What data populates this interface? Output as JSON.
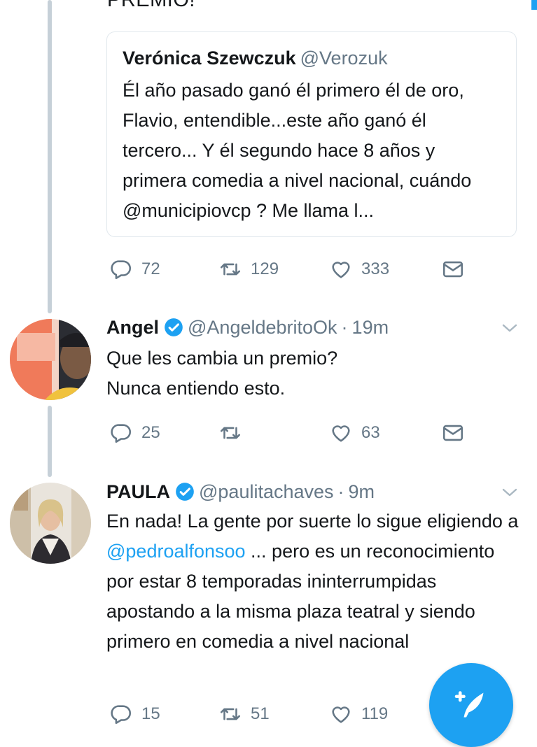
{
  "prev_tweet": {
    "text_fragment": "PREMIO!",
    "quote": {
      "name": "Verónica Szewczuk",
      "handle": "@Verozuk",
      "text": "Él año pasado ganó él primero él de oro, Flavio, entendible...este año ganó él tercero... Y él segundo hace 8 años y primera comedia a nivel nacional, cuándo @municipiovcp ? Me llama l..."
    },
    "replies": "72",
    "retweets": "129",
    "likes": "333"
  },
  "tweets": [
    {
      "name": "Angel",
      "verified": true,
      "handle": "@AngeldebritoOk",
      "separator": "·",
      "time": "19m",
      "line1": "Que les cambia un premio?",
      "line2": "Nunca entiendo esto.",
      "replies": "25",
      "retweets": "",
      "likes": "63"
    },
    {
      "name": "PAULA",
      "verified": true,
      "handle": "@paulitachaves",
      "separator": "·",
      "time": "9m",
      "text_before": "En nada! La gente por suerte lo sigue eligiendo a ",
      "mention": "@pedroalfonsoo",
      "text_after": " ... pero es un reconocimiento por estar 8 temporadas ininterrumpidas apostando a la misma plaza teatral y siendo primero en comedia a nivel nacional",
      "replies": "15",
      "retweets": "51",
      "likes": "119"
    }
  ],
  "icons": {
    "reply": "reply-icon",
    "retweet": "retweet-icon",
    "like": "heart-icon",
    "dm": "envelope-icon",
    "verified": "verified-badge-icon",
    "compose": "compose-tweet-icon"
  },
  "colors": {
    "accent": "#1da1f2",
    "secondary_text": "#657786",
    "thread_line": "#c6d0d8"
  }
}
